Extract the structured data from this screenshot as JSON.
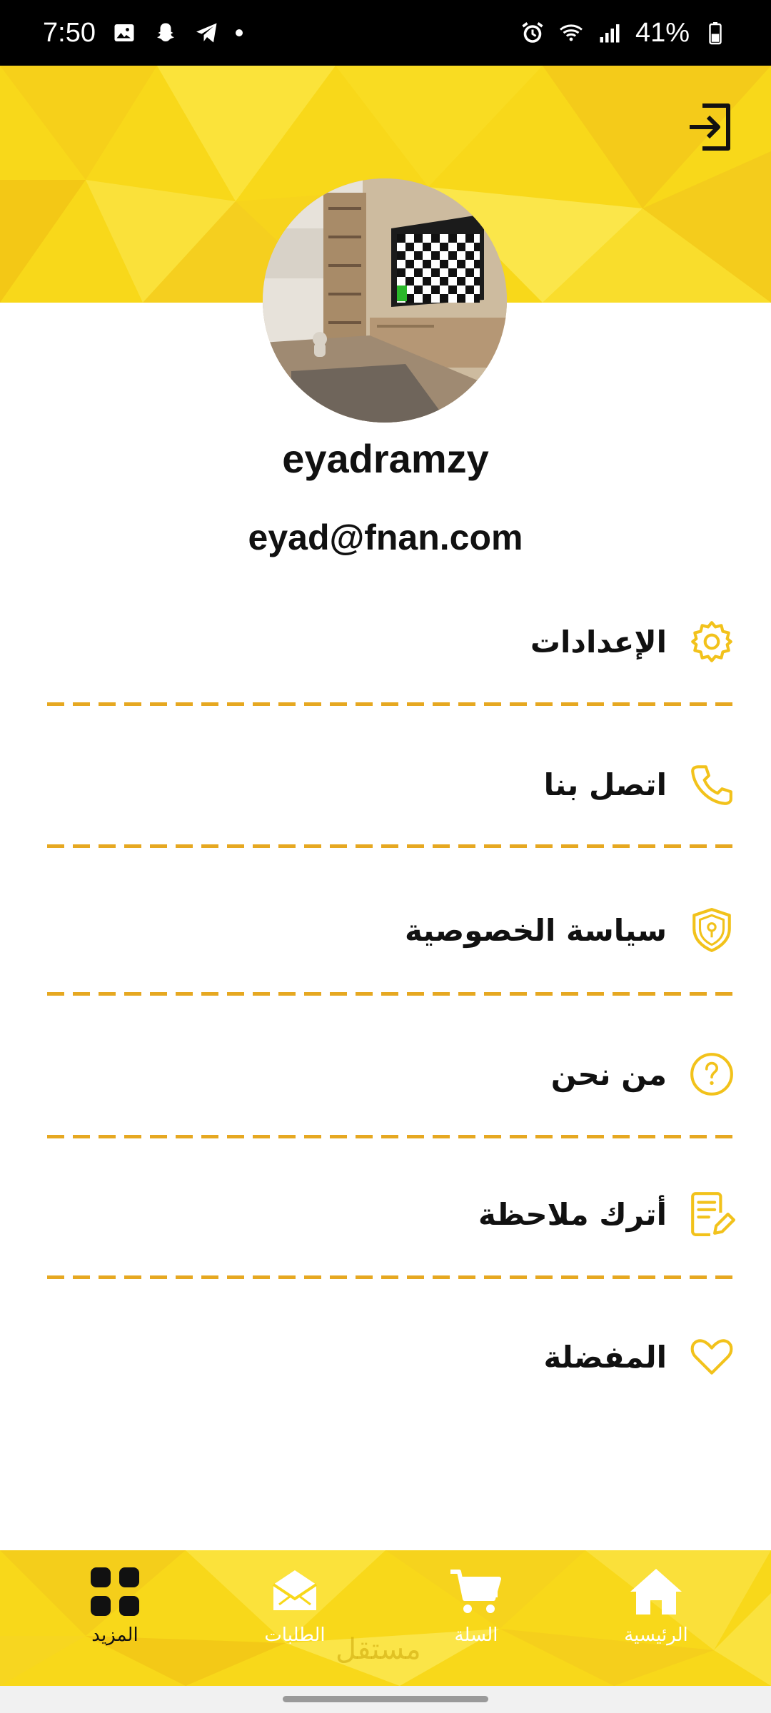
{
  "status_bar": {
    "time": "7:50",
    "battery": "41%",
    "icons": [
      "gallery-icon",
      "snapchat-icon",
      "telegram-icon",
      "notification-dot",
      "alarm-icon",
      "wifi-icon",
      "signal-icon",
      "battery-icon"
    ]
  },
  "header": {
    "logout_icon": "logout-icon"
  },
  "profile": {
    "username": "eyadramzy",
    "email": "eyad@fnan.com"
  },
  "menu": {
    "items": [
      {
        "label": "الإعدادات",
        "icon": "gear-icon"
      },
      {
        "label": "اتصل بنا",
        "icon": "phone-icon"
      },
      {
        "label": "سياسة الخصوصية",
        "icon": "shield-lock-icon"
      },
      {
        "label": "من نحن",
        "icon": "question-circle-icon"
      },
      {
        "label": "أترك ملاحظة",
        "icon": "note-edit-icon"
      },
      {
        "label": "المفضلة",
        "icon": "heart-icon"
      }
    ]
  },
  "bottom_nav": {
    "items": [
      {
        "label": "المزيد",
        "icon": "grid-icon",
        "active": true
      },
      {
        "label": "الطلبات",
        "icon": "mail-icon",
        "active": false
      },
      {
        "label": "السلة",
        "icon": "cart-icon",
        "active": false
      },
      {
        "label": "الرئيسية",
        "icon": "home-icon",
        "active": false
      }
    ],
    "watermark": "مستقل"
  },
  "colors": {
    "brand_yellow": "#f8d81a",
    "accent_gold": "#e6a821",
    "icon_yellow": "#f2c21b"
  }
}
